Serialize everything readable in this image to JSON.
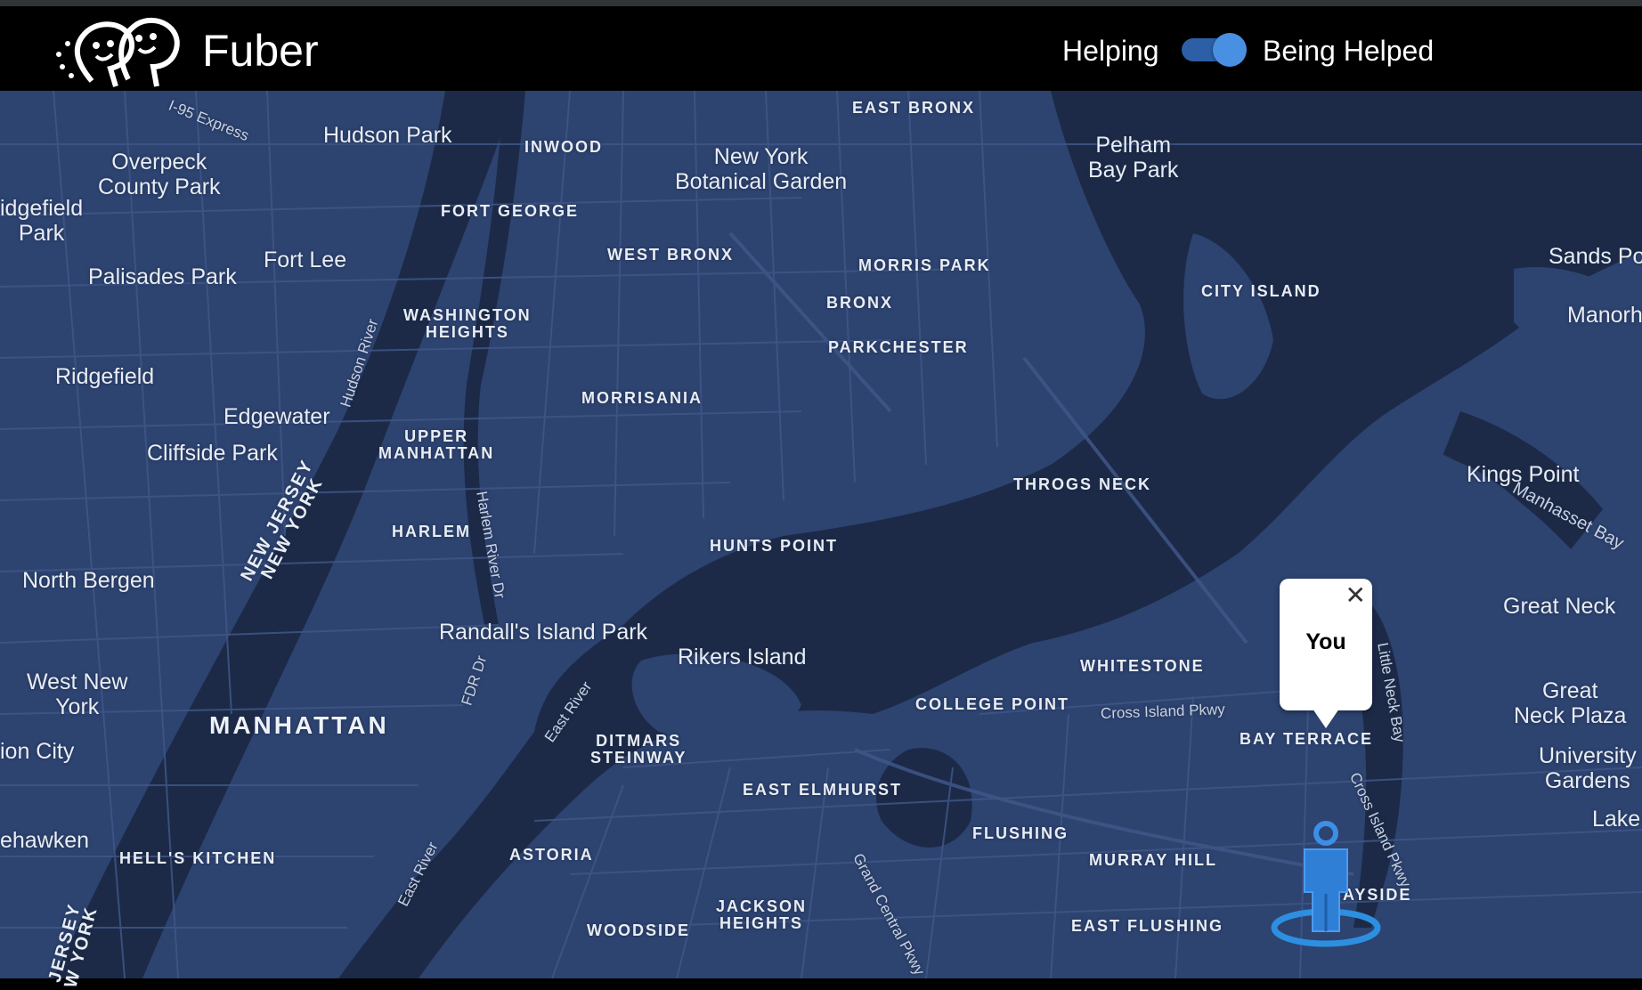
{
  "header": {
    "brand": "Fuber",
    "toggle": {
      "left_label": "Helping",
      "right_label": "Being Helped",
      "state": "Being Helped"
    }
  },
  "map": {
    "places": {
      "i95": "I-95 Express",
      "hudson_park": "Hudson Park",
      "overpeck": "Overpeck\nCounty Park",
      "ridgefield_park": "idgefield\nPark",
      "fort_lee": "Fort Lee",
      "palisades": "Palisades Park",
      "ridgefield": "Ridgefield",
      "edgewater": "Edgewater",
      "cliffside": "Cliffside Park",
      "north_bergen": "North Bergen",
      "west_new_york": "West New\nYork",
      "union_city": "ion City",
      "hoboken": "ehawken",
      "botanical": "New York\nBotanical Garden",
      "pelham": "Pelham\nBay Park",
      "sands_point": "Sands Po",
      "manorhaven": "Manorh",
      "kings_point": "Kings Point",
      "great_neck": "Great Neck",
      "great_neck_plaza": "Great\nNeck Plaza",
      "university_gardens": "University\nGardens",
      "lake": "Lake",
      "randalls": "Randall's Island Park",
      "rikers": "Rikers Island",
      "manhasset_bay": "Manhasset Bay"
    },
    "neighborhoods": {
      "east_bronx": "EAST BRONX",
      "inwood": "INWOOD",
      "fort_george": "FORT GEORGE",
      "west_bronx": "WEST BRONX",
      "morris_park": "MORRIS PARK",
      "bronx": "BRONX",
      "city_island": "CITY ISLAND",
      "washington_heights": "WASHINGTON\nHEIGHTS",
      "parkchester": "PARKCHESTER",
      "morrisania": "MORRISANIA",
      "upper_manhattan": "UPPER\nMANHATTAN",
      "throgs_neck": "THROGS NECK",
      "harlem": "HARLEM",
      "hunts_point": "HUNTS POINT",
      "whitestone": "WHITESTONE",
      "college_point": "COLLEGE POINT",
      "bay_terrace": "BAY TERRACE",
      "ditmars": "DITMARS\nSTEINWAY",
      "east_elmhurst": "EAST ELMHURST",
      "flushing": "FLUSHING",
      "murray_hill": "MURRAY HILL",
      "hells_kitchen": "HELL'S KITCHEN",
      "astoria": "ASTORIA",
      "jackson_heights": "JACKSON\nHEIGHTS",
      "woodside": "WOODSIDE",
      "east_flushing": "EAST FLUSHING",
      "bayside": "BAYSIDE",
      "manhattan": "MANHATTAN",
      "nj_ny": "NEW JERSEY\nNEW YORK",
      "nj_ny_bottom": "JERSEY\nW YORK"
    },
    "roads": {
      "hudson_river": "Hudson River",
      "harlem_river_dr": "Harlem River Dr",
      "fdr_dr": "FDR Dr",
      "east_river": "East River",
      "east_river_2": "East River",
      "grand_central": "Grand Central Pkwy",
      "cross_island": "Cross Island Pkwy",
      "cross_island_2": "Cross Island Pkwy",
      "little_neck_bay": "Little Neck Bay"
    },
    "marker": {
      "label": "You",
      "icon": "person-pin-icon"
    },
    "colors": {
      "land": "#2d4370",
      "water": "#1c2a47",
      "road": "#3f5687"
    }
  }
}
